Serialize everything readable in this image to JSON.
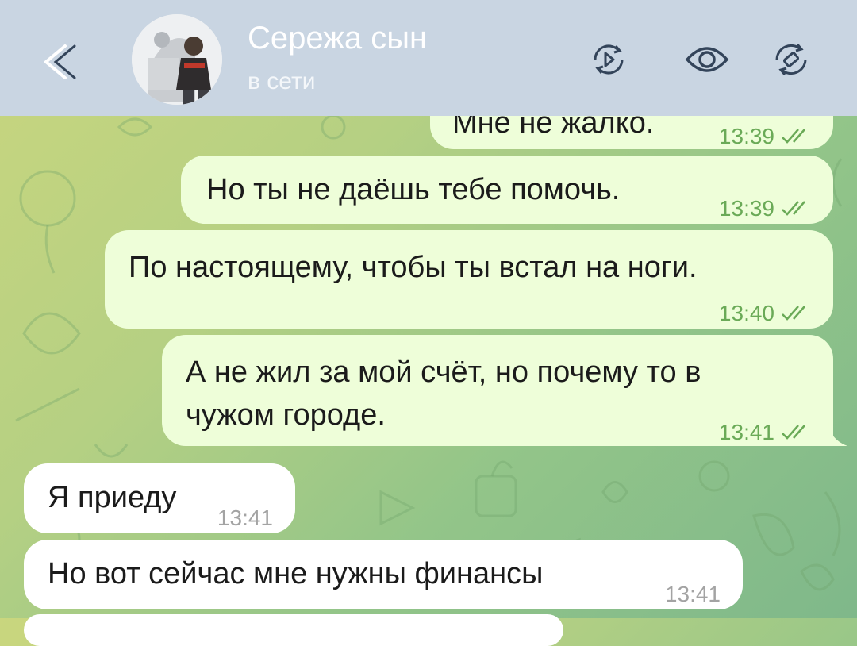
{
  "header": {
    "contact_name": "Сережа сын",
    "status": "в сети",
    "icons": [
      "back-arrow-icon",
      "video-call-icon",
      "eye-icon",
      "auto-delete-icon"
    ]
  },
  "messages": [
    {
      "direction": "out",
      "text": "Мне не жалко.",
      "time": "13:39",
      "read": true
    },
    {
      "direction": "out",
      "text": "Но ты не даёшь тебе помочь.",
      "time": "13:39",
      "read": true
    },
    {
      "direction": "out",
      "text": "По настоящему, чтобы ты встал на ноги.",
      "time": "13:40",
      "read": true
    },
    {
      "direction": "out",
      "lines": [
        "А не жил за мой счёт, но почему то в",
        "чужом городе."
      ],
      "time": "13:41",
      "read": true
    },
    {
      "direction": "in",
      "text": "Я приеду",
      "time": "13:41"
    },
    {
      "direction": "in",
      "text": "Но вот сейчас мне нужны финансы",
      "time": "13:41"
    }
  ],
  "colors": {
    "header_bg": "#c9d5e2",
    "outgoing_bubble": "#eefed9",
    "incoming_bubble": "#ffffff",
    "read_check": "#6aaa57"
  }
}
